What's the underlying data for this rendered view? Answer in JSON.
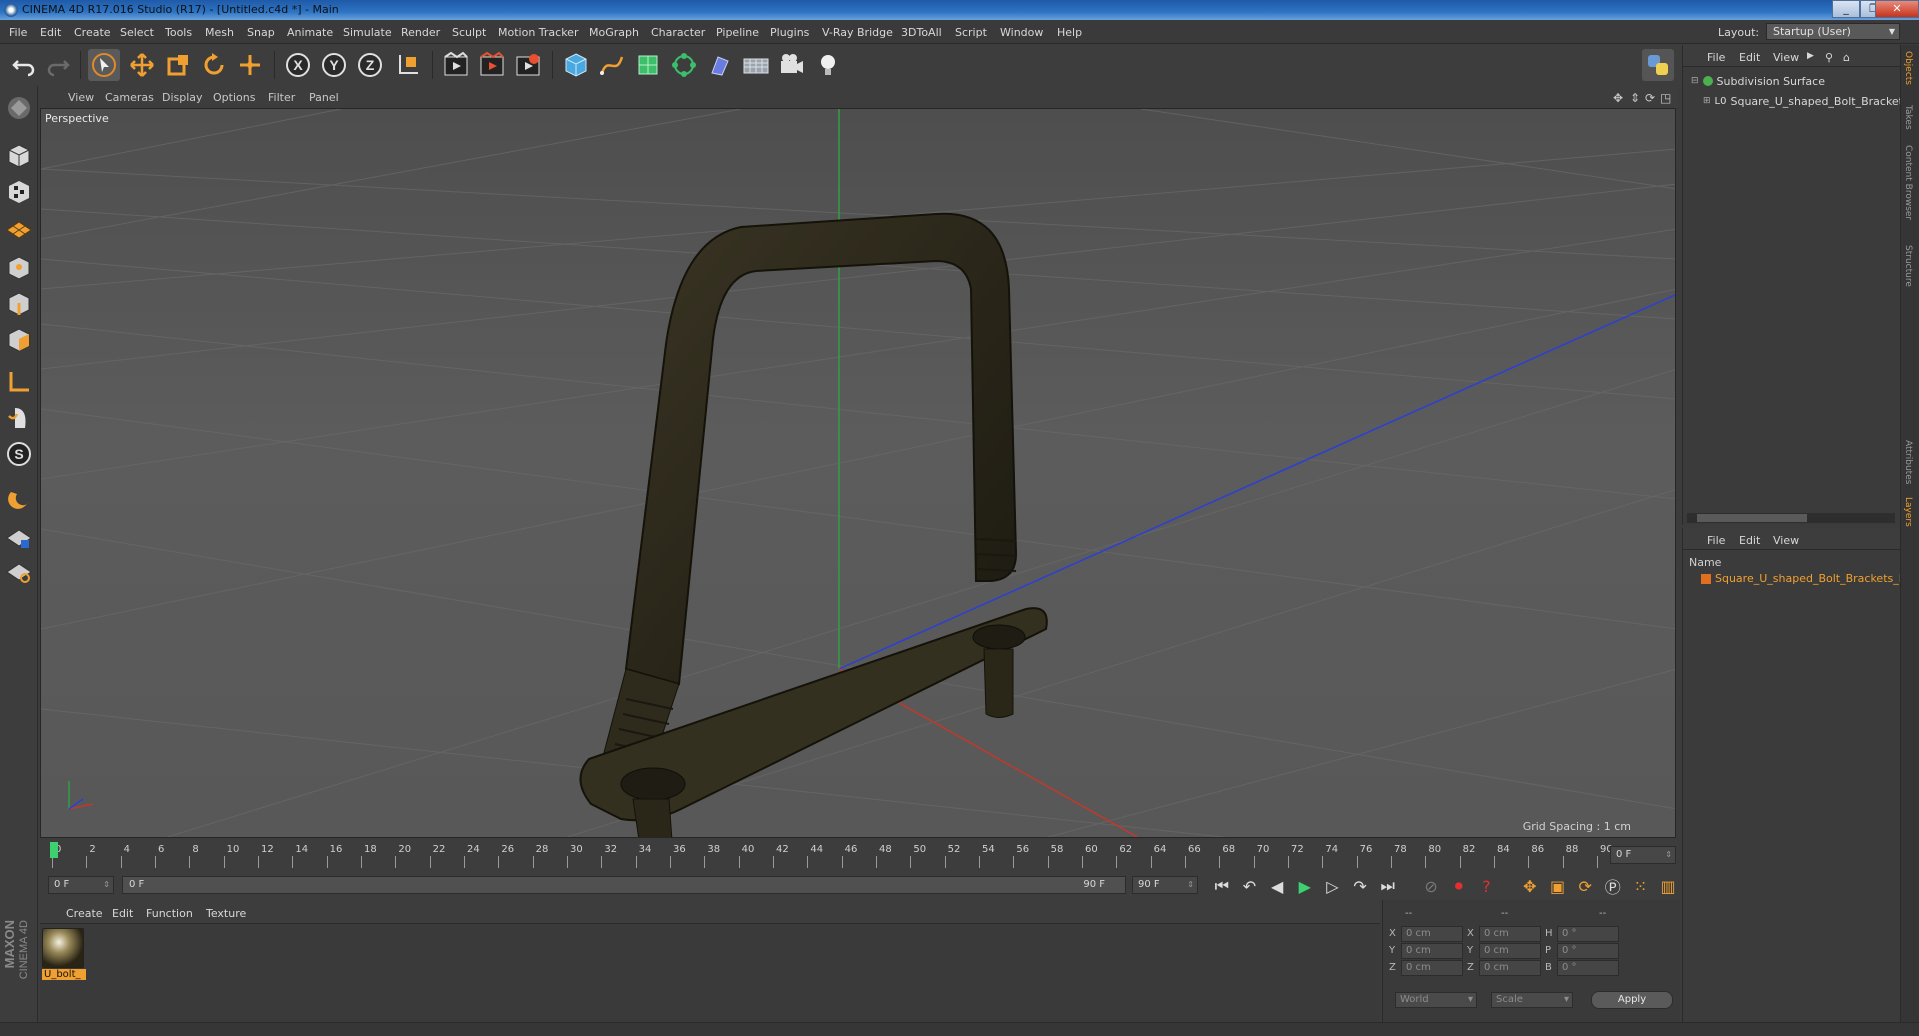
{
  "window": {
    "title": "CINEMA 4D R17.016 Studio (R17) - [Untitled.c4d *] - Main",
    "minimize": "_",
    "restore": "❐",
    "close": "✕"
  },
  "menu": [
    "File",
    "Edit",
    "Create",
    "Select",
    "Tools",
    "Mesh",
    "Snap",
    "Animate",
    "Simulate",
    "Render",
    "Sculpt",
    "Motion Tracker",
    "MoGraph",
    "Character",
    "Pipeline",
    "Plugins",
    "V-Ray Bridge",
    "3DToAll",
    "Script",
    "Window",
    "Help"
  ],
  "layout": {
    "label": "Layout:",
    "value": "Startup (User)"
  },
  "toolbar": {
    "icons": [
      "undo-icon",
      "redo-icon",
      "select-arrow-icon",
      "move-icon",
      "scale-icon",
      "rotate-icon",
      "transform-icon",
      "x-axis-icon",
      "y-axis-icon",
      "z-axis-icon",
      "coordinate-system-icon",
      "render-view-icon",
      "render-picture-viewer-icon",
      "render-settings-icon",
      "cube-icon",
      "spline-pen-icon",
      "subdivision-icon",
      "array-icon",
      "deformer-icon",
      "floor-icon",
      "camera-icon",
      "light-icon",
      "python-icon"
    ],
    "axis_labels": {
      "x": "X",
      "y": "Y",
      "z": "Z"
    }
  },
  "viewport": {
    "menu": [
      "View",
      "Cameras",
      "Display",
      "Options",
      "Filter",
      "Panel"
    ],
    "camera_label": "Perspective",
    "grid_spacing": "Grid Spacing : 1 cm",
    "accent_colors": {
      "x_axis": "#c0392b",
      "y_axis": "#2ea043",
      "z_axis": "#2b3fd6"
    }
  },
  "timeline": {
    "ticks": [
      "0",
      "2",
      "4",
      "6",
      "8",
      "10",
      "12",
      "14",
      "16",
      "18",
      "20",
      "22",
      "24",
      "26",
      "28",
      "30",
      "32",
      "34",
      "36",
      "38",
      "40",
      "42",
      "44",
      "46",
      "48",
      "50",
      "52",
      "54",
      "56",
      "58",
      "60",
      "62",
      "64",
      "66",
      "68",
      "70",
      "72",
      "74",
      "76",
      "78",
      "80",
      "82",
      "84",
      "86",
      "88",
      "90"
    ],
    "current_frame": "0 F",
    "start_field": "0 F",
    "range_start": "0 F",
    "range_end": "90 F",
    "end_field": "90 F"
  },
  "material_manager": {
    "menu": [
      "Create",
      "Edit",
      "Function",
      "Texture"
    ],
    "materials": [
      {
        "name": "U_bolt_"
      }
    ]
  },
  "coordinates": {
    "headers": [
      "--",
      "--",
      "--"
    ],
    "rows": [
      {
        "pos_label": "X",
        "pos": "0 cm",
        "size_label": "X",
        "size": "0 cm",
        "rot_label": "H",
        "rot": "0 °"
      },
      {
        "pos_label": "Y",
        "pos": "0 cm",
        "size_label": "Y",
        "size": "0 cm",
        "rot_label": "P",
        "rot": "0 °"
      },
      {
        "pos_label": "Z",
        "pos": "0 cm",
        "size_label": "Z",
        "size": "0 cm",
        "rot_label": "B",
        "rot": "0 °"
      }
    ],
    "mode_select": "World",
    "size_select": "Scale",
    "apply_label": "Apply"
  },
  "object_manager": {
    "menu": [
      "File",
      "Edit",
      "View"
    ],
    "objects": [
      {
        "name": "Subdivision Surface",
        "color": "#4caf50"
      },
      {
        "name": "Square_U_shaped_Bolt_Brackets",
        "color": "#d0d0d0"
      }
    ]
  },
  "layer_manager": {
    "menu": [
      "File",
      "Edit",
      "View"
    ],
    "column": "Name",
    "layers": [
      {
        "name": "Square_U_shaped_Bolt_Brackets_I",
        "color": "#e07020"
      }
    ]
  },
  "right_tabs": [
    "Objects",
    "Takes",
    "Content Browser",
    "Structure",
    "Attributes",
    "Layers"
  ],
  "branding": {
    "company": "MAXON",
    "product": "CINEMA 4D"
  }
}
